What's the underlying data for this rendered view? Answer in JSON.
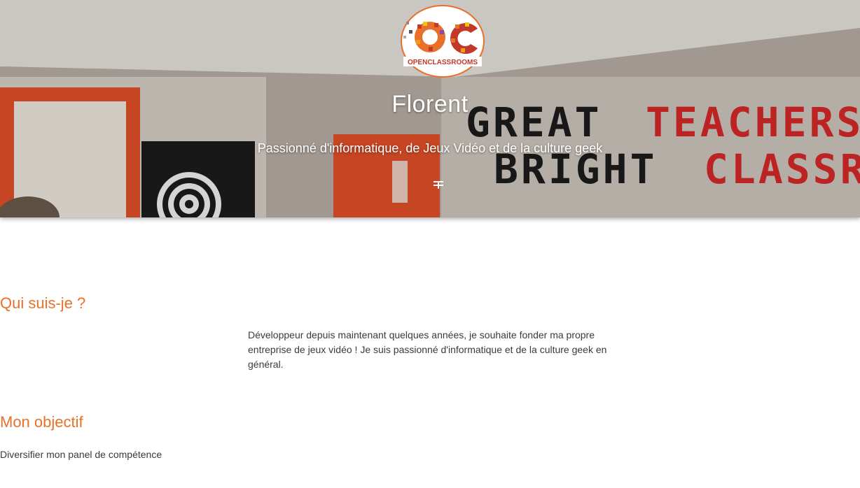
{
  "hero": {
    "name": "Florent",
    "tagline": "Passionné d'informatique, de Jeux Vidéo et de la culture geek",
    "logo_text": "OPENCLASSROOMS",
    "logo_letters": "oc",
    "background_wall_text_line1": "GREAT TEACHERS",
    "background_wall_text_line2": "BRIGHT CLASSROOMS",
    "divider_icon": "cross-divider-icon"
  },
  "sections": [
    {
      "title": "Qui suis-je ?",
      "text": "Développeur depuis maintenant quelques années, je souhaite fonder ma propre entreprise de jeux vidéo ! Je suis passionné d'informatique et de la culture geek en général."
    },
    {
      "title": "Mon objectif",
      "text": "Diversifier mon panel de compétence"
    }
  ],
  "colors": {
    "accent": "#e8702a",
    "text": "#3a3a3a",
    "hero_text": "#ffffff",
    "logo_orange": "#e8702a",
    "logo_red": "#c0392b"
  }
}
